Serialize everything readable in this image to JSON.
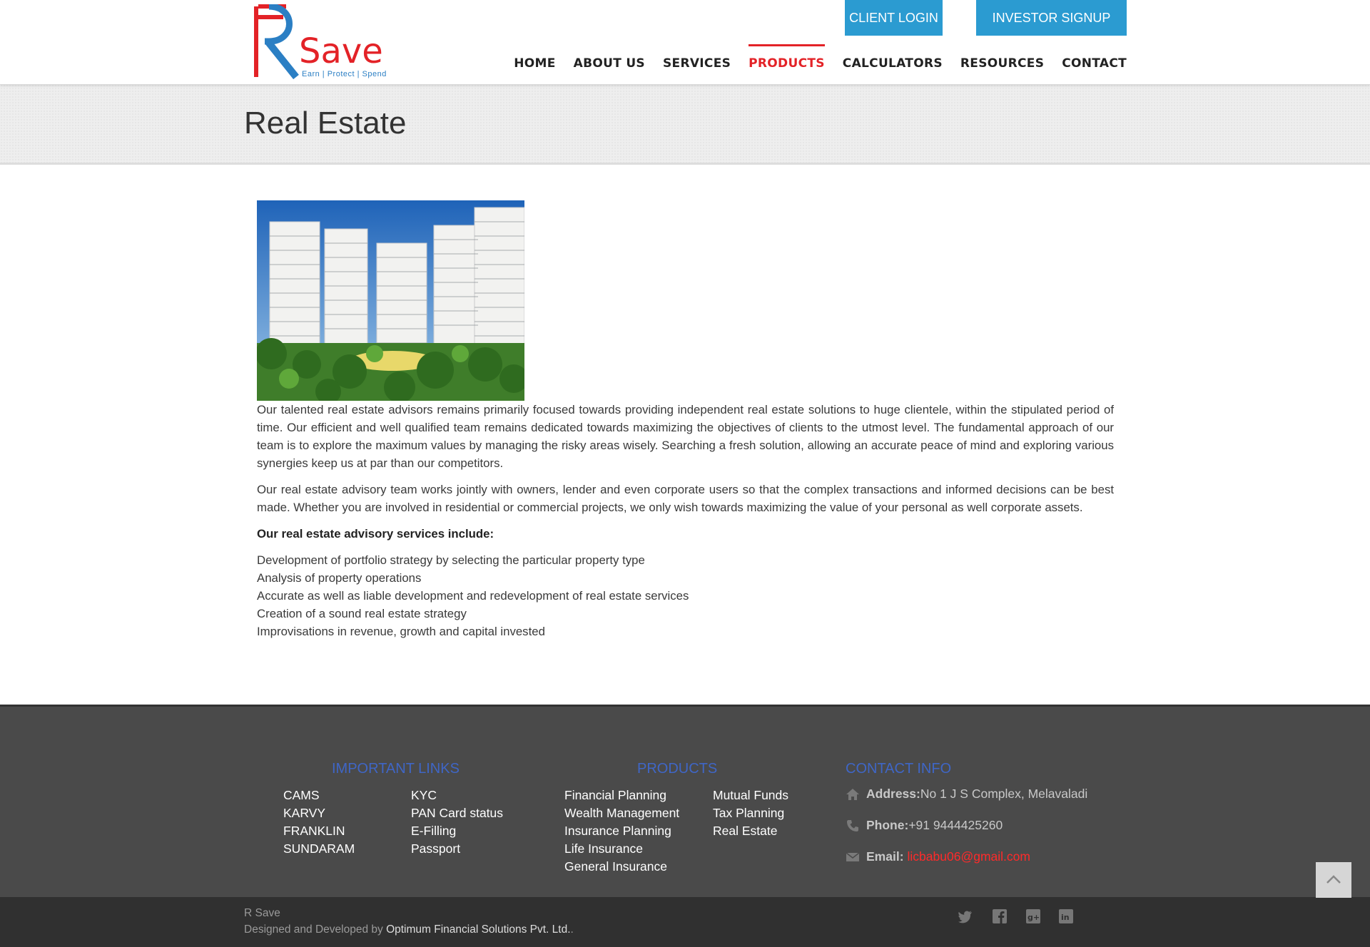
{
  "header": {
    "logo": {
      "brand_text": "Save",
      "tagline": "Earn | Protect | Spend",
      "colors": {
        "red": "#e32227",
        "blue": "#2b7fc4"
      }
    },
    "buttons": {
      "client_login": "CLIENT LOGIN",
      "investor_signup": "INVESTOR SIGNUP"
    },
    "nav": [
      {
        "label": "HOME",
        "active": false
      },
      {
        "label": "ABOUT US",
        "active": false
      },
      {
        "label": "SERVICES",
        "active": false
      },
      {
        "label": "PRODUCTS",
        "active": true
      },
      {
        "label": "CALCULATORS",
        "active": false
      },
      {
        "label": "RESOURCES",
        "active": false
      },
      {
        "label": "CONTACT",
        "active": false
      }
    ]
  },
  "page": {
    "title": "Real Estate",
    "hero_image": "residential-towers-illustration",
    "paragraphs": [
      "Our talented real estate advisors remains primarily focused towards providing independent real estate solutions to huge clientele, within the stipulated period of time. Our efficient and well qualified team remains dedicated towards maximizing the objectives of clients to the utmost level. The fundamental approach of our team is to explore the maximum values by managing the risky areas wisely. Searching a fresh solution, allowing an accurate peace of mind and exploring various synergies keep us at par than our competitors.",
      "Our real estate advisory team works jointly with owners, lender and even corporate users so that the complex transactions and informed decisions can be best made. Whether you are involved in residential or commercial projects, we only wish towards maximizing the value of your personal as well corporate assets."
    ],
    "services_heading": "Our real estate advisory services include:",
    "services": [
      "Development of portfolio strategy by selecting the particular property type",
      "Analysis of property operations",
      "Accurate as well as liable development and redevelopment of real estate services",
      "Creation of a sound real estate strategy",
      "Improvisations in revenue, growth and capital invested"
    ]
  },
  "footer": {
    "important_links": {
      "heading": "IMPORTANT LINKS",
      "col1": [
        "CAMS",
        "KARVY",
        "FRANKLIN",
        "SUNDARAM"
      ],
      "col2": [
        "KYC",
        "PAN Card status",
        "E-Filling",
        "Passport"
      ]
    },
    "products": {
      "heading": "PRODUCTS",
      "col1": [
        "Financial Planning",
        "Wealth Management",
        "Insurance Planning",
        "Life Insurance",
        "General Insurance"
      ],
      "col2": [
        "Mutual Funds",
        "Tax Planning",
        "Real Estate"
      ]
    },
    "contact": {
      "heading": "CONTACT INFO",
      "address_label": "Address:",
      "address": "No 1 J S Complex, Melavaladi",
      "phone_label": "Phone:",
      "phone": "+91 9444425260",
      "email_label": "Email:",
      "email": "licbabu06@gmail.com"
    },
    "copyright": {
      "name": "R Save",
      "designed_by": "Designed and Developed by ",
      "company": "Optimum Financial Solutions Pvt. Ltd.",
      "trailing": "."
    },
    "social_icons": [
      "twitter-icon",
      "facebook-icon",
      "google-plus-icon",
      "linkedin-icon"
    ]
  },
  "theme": {
    "accent_blue": "#2b9bd1",
    "active_red": "#e32227",
    "footer_heading_blue": "#3f66c6",
    "email_red": "#ff2a2a"
  }
}
